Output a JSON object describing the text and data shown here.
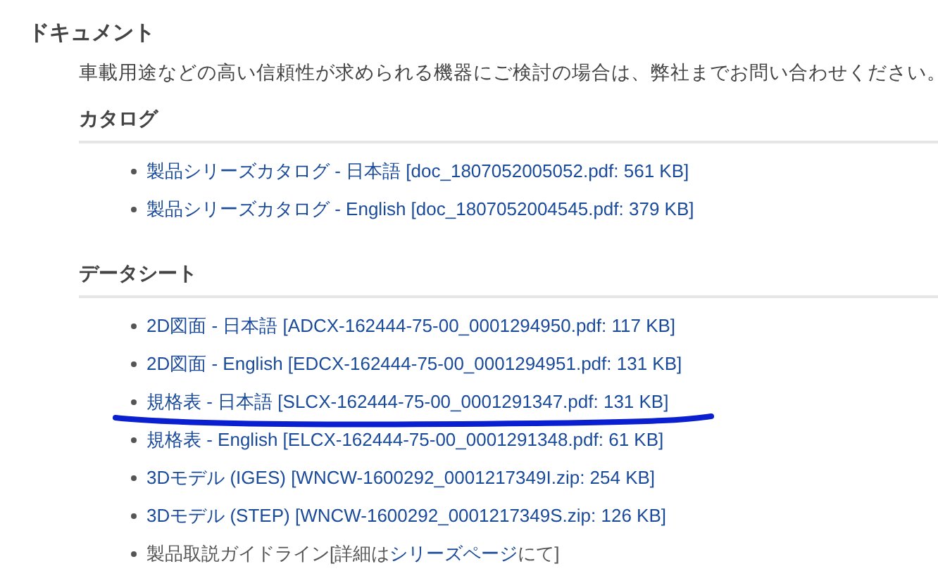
{
  "title": "ドキュメント",
  "note": "車載用途などの高い信頼性が求められる機器にご検討の場合は、弊社までお問い合わせください。",
  "sections": [
    {
      "heading": "カタログ",
      "items": [
        {
          "kind": "link",
          "text": "製品シリーズカタログ - 日本語 [doc_1807052005052.pdf: 561 KB]",
          "underlined": false
        },
        {
          "kind": "link",
          "text": "製品シリーズカタログ - English [doc_1807052004545.pdf: 379 KB]",
          "underlined": false
        }
      ]
    },
    {
      "heading": "データシート",
      "items": [
        {
          "kind": "link",
          "text": "2D図面 - 日本語 [ADCX-162444-75-00_0001294950.pdf: 117 KB]",
          "underlined": false
        },
        {
          "kind": "link",
          "text": "2D図面 - English [EDCX-162444-75-00_0001294951.pdf: 131 KB]",
          "underlined": false
        },
        {
          "kind": "link",
          "text": "規格表 - 日本語 [SLCX-162444-75-00_0001291347.pdf: 131 KB]",
          "underlined": true
        },
        {
          "kind": "link",
          "text": "規格表 - English [ELCX-162444-75-00_0001291348.pdf: 61 KB]",
          "underlined": false
        },
        {
          "kind": "link",
          "text": "3Dモデル (IGES) [WNCW-1600292_0001217349I.zip: 254 KB]",
          "underlined": false
        },
        {
          "kind": "link",
          "text": "3Dモデル (STEP) [WNCW-1600292_0001217349S.zip: 126 KB]",
          "underlined": false
        },
        {
          "kind": "text",
          "before": "製品取説ガイドライン[詳細は",
          "link": "シリーズページ",
          "after": "にて]",
          "underlined": false
        }
      ]
    }
  ]
}
